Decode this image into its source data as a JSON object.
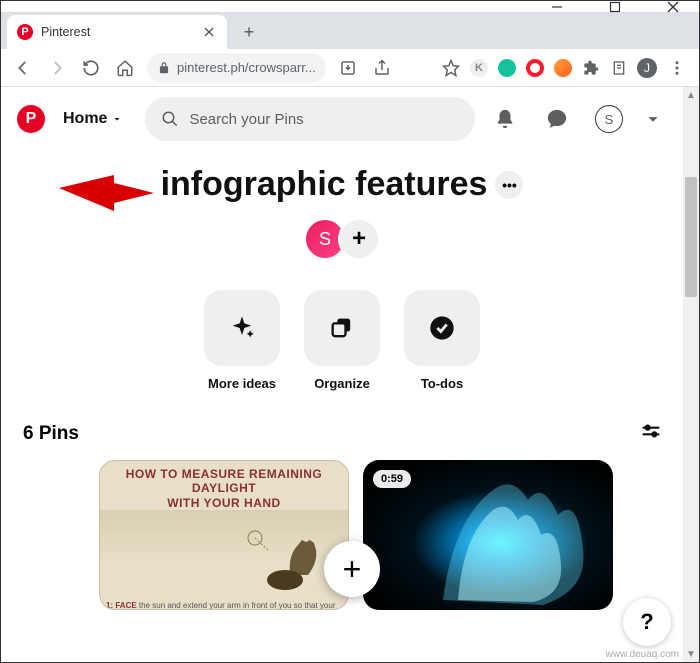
{
  "window": {
    "tab_title": "Pinterest"
  },
  "browser": {
    "url": "pinterest.ph/crowsparr...",
    "avatar_letter": "J"
  },
  "header": {
    "home_label": "Home",
    "search_placeholder": "Search your Pins",
    "account_letter": "S"
  },
  "board": {
    "title": "infographic features",
    "owner_initial": "S"
  },
  "tiles": {
    "more_ideas": "More ideas",
    "organize": "Organize",
    "todos": "To-dos"
  },
  "pins": {
    "count_label": "6 Pins",
    "pin1_title_line1": "HOW TO MEASURE REMAINING DAYLIGHT",
    "pin1_title_line2": "WITH YOUR HAND",
    "pin1_caption_num": "1:",
    "pin1_caption_bold": "FACE",
    "pin1_caption_rest": " the sun and extend your arm in front of you so that your palm faces toward you and fingers are parallel to horizon.",
    "pin2_duration": "0:59"
  },
  "help_label": "?",
  "watermark": "www.deuaq.com"
}
